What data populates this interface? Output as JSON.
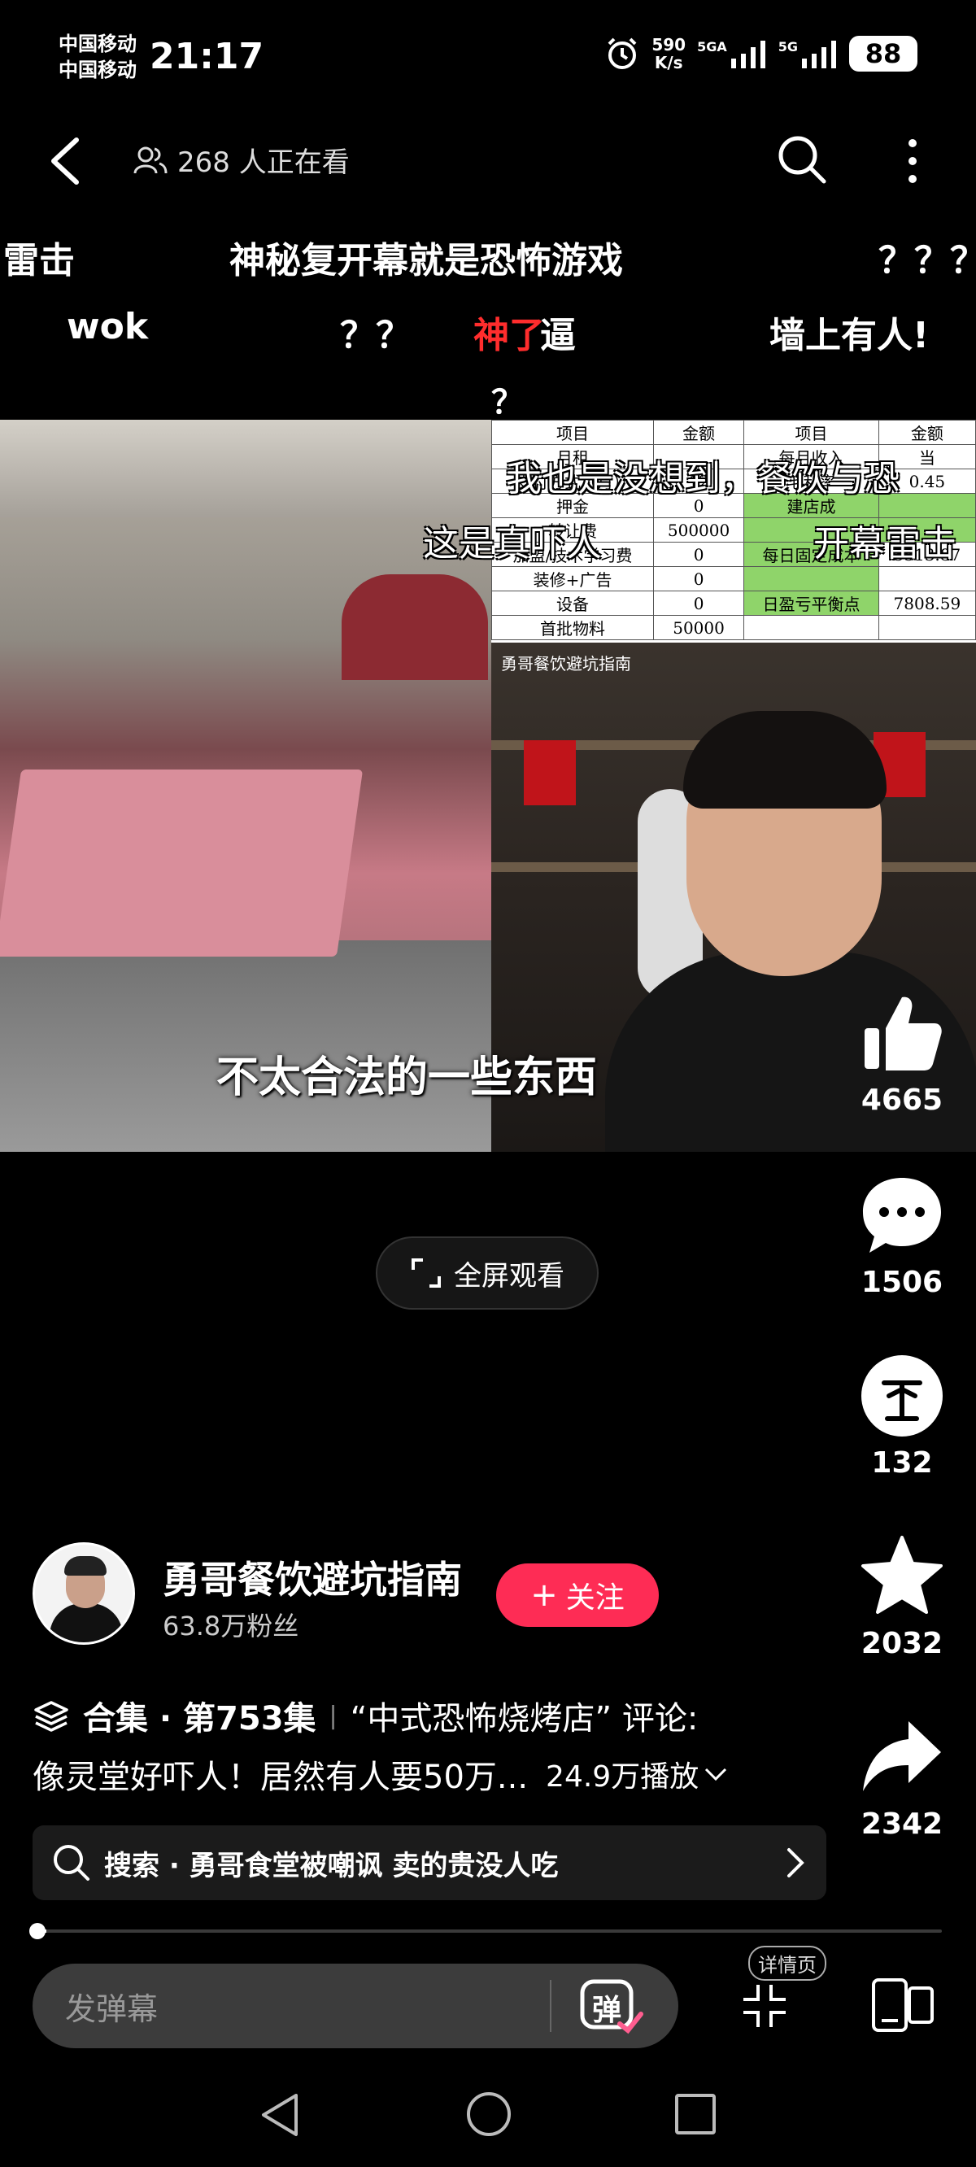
{
  "status_bar": {
    "carrier_1": "中国移动",
    "carrier_2": "中国移动",
    "time": "21:17",
    "net_speed_value": "590",
    "net_speed_unit": "K/s",
    "signal_1": "5GA",
    "signal_2": "5G",
    "battery": "88"
  },
  "header": {
    "viewers": "268 人正在看"
  },
  "danmaku": [
    "雷击",
    "神秘复开幕就是恐怖游戏",
    "？？？",
    "wok",
    "？？",
    "神了",
    "逼",
    "墙上有人!",
    "？"
  ],
  "video": {
    "channel_watermark": "勇哥餐饮避坑指南",
    "caption": "不太合法的一些东西",
    "overlay_texts": [
      "我也是没想到，餐饮与恐",
      "这是真吓人",
      "开幕雷击"
    ],
    "sheet_rows": [
      [
        "项目",
        "金额",
        "项目",
        "金额"
      ],
      [
        "月租",
        "",
        "每月收入",
        "当"
      ],
      [
        "支付方式（月）",
        "12",
        "毛利率",
        "0.45"
      ],
      [
        "押金",
        "0",
        "建店成",
        ""
      ],
      [
        "转让费",
        "500000",
        "",
        ""
      ],
      [
        "加盟/技术学习费",
        "0",
        "每日固定成本",
        "3513.87"
      ],
      [
        "装修+广告",
        "0",
        "",
        ""
      ],
      [
        "设备",
        "0",
        "日盈亏平衡点",
        "7808.59"
      ],
      [
        "首批物料",
        "50000",
        "",
        ""
      ]
    ]
  },
  "fullscreen_label": "全屏观看",
  "actions": {
    "like_count": "4665",
    "comment_count": "1506",
    "coin_count": "132",
    "favorite_count": "2032",
    "share_count": "2342"
  },
  "author": {
    "name": "勇哥餐饮避坑指南",
    "fans": "63.8万粉丝",
    "follow_label": "关注"
  },
  "description": {
    "collection": "合集 · 第753集",
    "title_line_1": "“中式恐怖烧烤店” 评论:",
    "title_line_2": "像灵堂好吓人！居然有人要50万...",
    "plays": "24.9万播放"
  },
  "search_bar": {
    "label": "搜索 · 勇哥食堂被嘲讽 卖的贵没人吃"
  },
  "progress": {
    "fraction": 0.01
  },
  "bottom_bar": {
    "danmaku_placeholder": "发弹幕",
    "danmaku_toggle_label": "弹",
    "detail_label": "详情页"
  },
  "colors": {
    "follow": "#fe2c55",
    "background": "#000000"
  }
}
